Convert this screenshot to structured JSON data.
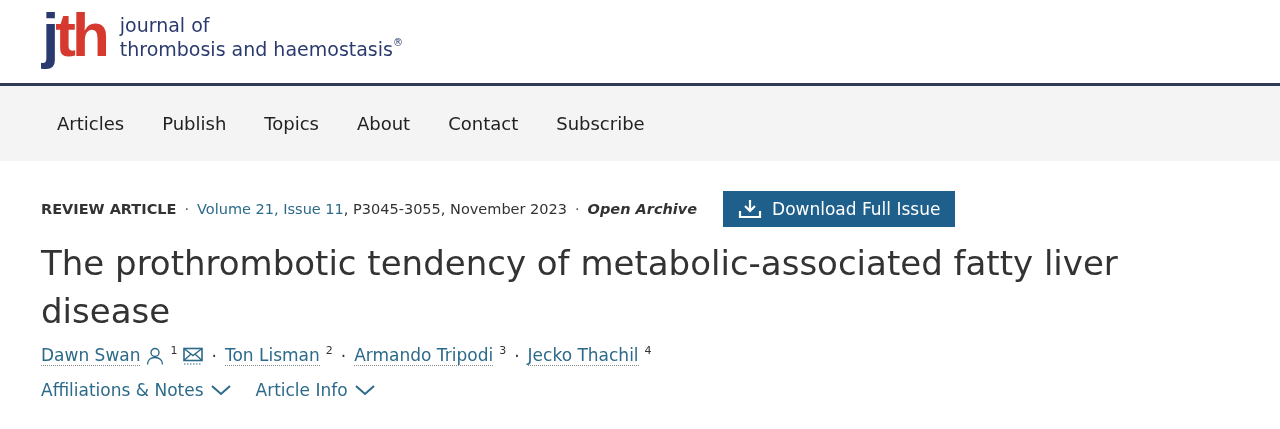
{
  "logo": {
    "letters": [
      {
        "text": "j",
        "color": "#2a3a6e"
      },
      {
        "text": "th",
        "color": "#d63a2f"
      }
    ],
    "name_line_1": "journal of",
    "name_line_2": "thrombosis and haemostasis",
    "registered": "®"
  },
  "nav": {
    "items": [
      "Articles",
      "Publish",
      "Topics",
      "About",
      "Contact",
      "Subscribe"
    ]
  },
  "article": {
    "type": "REVIEW ARTICLE",
    "separator": "·",
    "volume": "Volume 21, Issue 11",
    "pages": ", P3045-3055, November 2023",
    "access": "Open Archive",
    "download_button": "Download Full Issue",
    "title": "The prothrombotic tendency of metabolic-associated fatty liver disease",
    "authors": [
      {
        "name": "Dawn Swan",
        "sup": "1",
        "corresponding": true
      },
      {
        "name": "Ton Lisman",
        "sup": "2",
        "corresponding": false
      },
      {
        "name": "Armando Tripodi",
        "sup": "3",
        "corresponding": false
      },
      {
        "name": "Jecko Thachil",
        "sup": "4",
        "corresponding": false
      }
    ],
    "toggles": [
      {
        "label": "Affiliations & Notes",
        "expanded": false
      },
      {
        "label": "Article Info",
        "expanded": false
      }
    ]
  }
}
